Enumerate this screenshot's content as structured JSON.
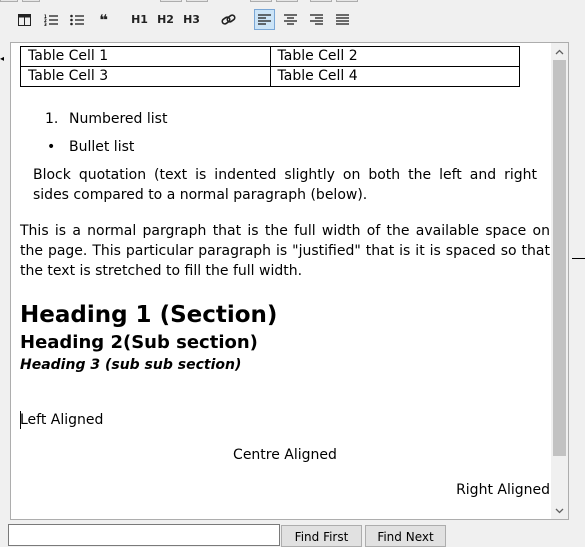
{
  "toolbar": {
    "buttons": [
      {
        "name": "table-icon",
        "label": ""
      },
      {
        "name": "numbered-list-icon",
        "label": ""
      },
      {
        "name": "bullet-list-icon",
        "label": ""
      },
      {
        "name": "blockquote-icon",
        "label": "❝"
      },
      {
        "name": "heading-1-button",
        "label": "H1"
      },
      {
        "name": "heading-2-button",
        "label": "H2"
      },
      {
        "name": "heading-3-button",
        "label": "H3"
      },
      {
        "name": "link-icon",
        "label": ""
      },
      {
        "name": "align-left-icon",
        "label": "",
        "active": true
      },
      {
        "name": "align-center-icon",
        "label": ""
      },
      {
        "name": "align-right-icon",
        "label": ""
      },
      {
        "name": "justify-icon",
        "label": ""
      }
    ],
    "active_color": "#cce4f7"
  },
  "document": {
    "table": [
      [
        "Table Cell 1",
        "Table Cell 2"
      ],
      [
        "Table Cell 3",
        "Table Cell 4"
      ]
    ],
    "numbered_list": {
      "marker": "1.",
      "text": "Numbered list"
    },
    "bullet_list": {
      "marker": "•",
      "text": "Bullet list"
    },
    "blockquote": "Block quotation (text is indented slightly on both the left and right sides compared to a normal paragraph (below).",
    "paragraph": "This is a normal pargraph that is the full width of the available space on the page. This particular paragraph is \"justified\" that is it is spaced so that the text is stretched to fill the full width.",
    "heading1": "Heading 1 (Section)",
    "heading2": "Heading 2(Sub section)",
    "heading3": "Heading 3 (sub sub section)",
    "left_aligned": "Left Aligned",
    "centre_aligned": "Centre Aligned",
    "right_aligned": "Right Aligned"
  },
  "find_bar": {
    "input_value": "",
    "find_first_label": "Find First",
    "find_next_label": "Find Next"
  }
}
